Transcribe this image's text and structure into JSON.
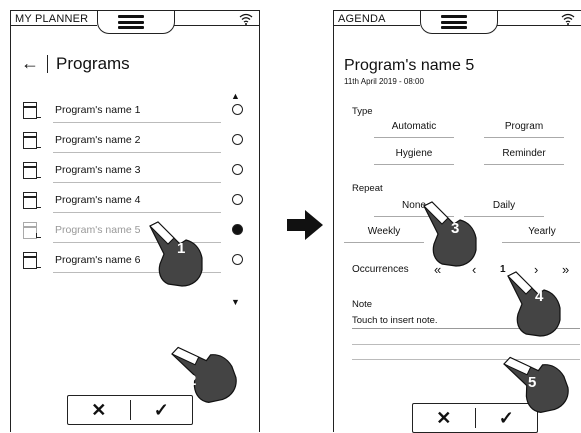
{
  "left": {
    "app_name": "MY PLANNER",
    "back_glyph": "←",
    "title": "Programs",
    "programs": [
      {
        "label": "Program's name 1",
        "selected": false
      },
      {
        "label": "Program's name 2",
        "selected": false
      },
      {
        "label": "Program's name 3",
        "selected": false
      },
      {
        "label": "Program's name 4",
        "selected": false
      },
      {
        "label": "Program's name 5",
        "selected": true
      },
      {
        "label": "Program's name 6",
        "selected": false
      }
    ],
    "cancel_glyph": "✕",
    "confirm_glyph": "✓"
  },
  "right": {
    "app_name": "AGENDA",
    "title": "Program's name 5",
    "date": "11th April 2019 - 08:00",
    "type_label": "Type",
    "type_options": [
      "Automatic",
      "Program",
      "Hygiene",
      "Reminder"
    ],
    "repeat_label": "Repeat",
    "repeat_options": [
      "None",
      "Daily",
      "Weekly",
      "Yearly"
    ],
    "occurrences_label": "Occurrences",
    "occ_first": "«",
    "occ_prev": "‹",
    "occ_value": "1",
    "occ_next": "›",
    "occ_last": "»",
    "note_label": "Note",
    "note_placeholder": "Touch to insert note.",
    "cancel_glyph": "✕",
    "confirm_glyph": "✓"
  },
  "callouts": [
    "1",
    "2",
    "3",
    "4",
    "5"
  ],
  "icons": {
    "menu": "hamburger-menu-icon",
    "wifi": "wifi-icon",
    "arrow": "right-arrow-icon",
    "doc": "document-icon",
    "hand": "pointing-hand-icon"
  }
}
